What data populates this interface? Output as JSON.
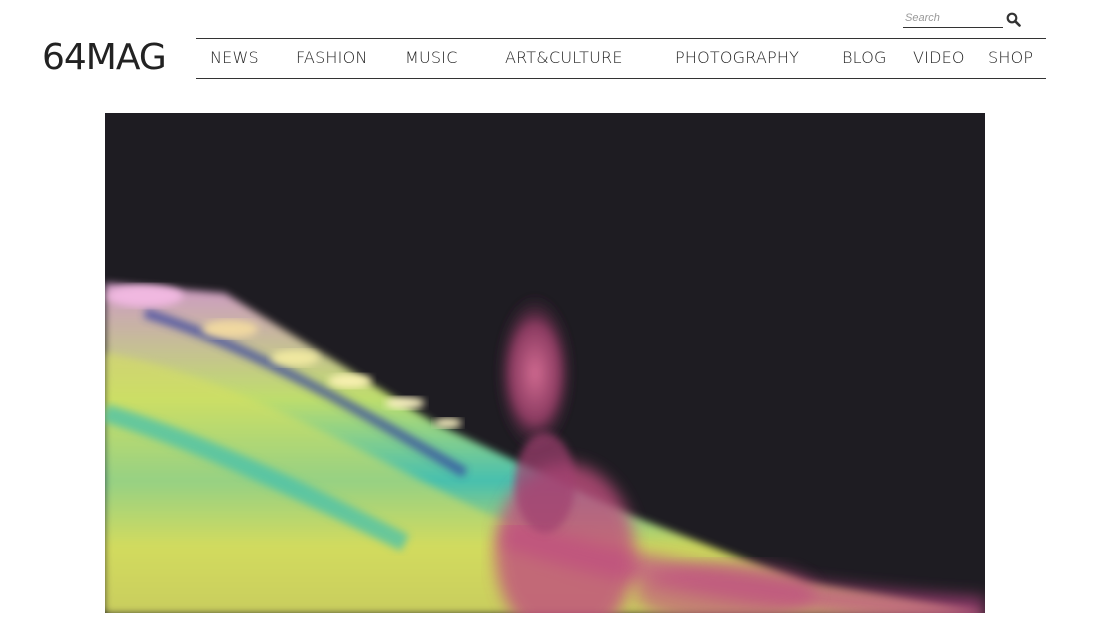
{
  "logo": {
    "text": "64MAG"
  },
  "search": {
    "placeholder": "Search",
    "icon": "magnifier-icon"
  },
  "nav": {
    "items": [
      {
        "label": "NEWS"
      },
      {
        "label": "FASHION"
      },
      {
        "label": "MUSIC"
      },
      {
        "label": "ART&CULTURE"
      },
      {
        "label": "PHOTOGRAPHY"
      },
      {
        "label": "BLOG"
      },
      {
        "label": "VIDEO"
      },
      {
        "label": "SHOP"
      }
    ]
  },
  "hero": {
    "description_colors": {
      "background": "#1e1c22",
      "accent_pink": "#c0507e",
      "accent_yellow": "#d6e060",
      "accent_cyan": "#48c8b8"
    }
  }
}
